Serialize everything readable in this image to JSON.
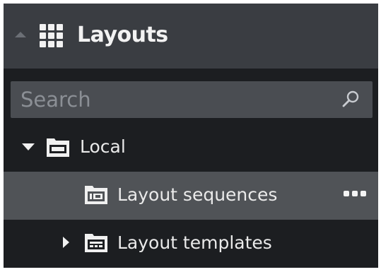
{
  "header": {
    "title": "Layouts",
    "collapse_icon": "collapse-up-arrow-icon",
    "section_icon": "grid-icon"
  },
  "search": {
    "value": "",
    "placeholder": "Search",
    "icon": "search-icon"
  },
  "tree": {
    "items": [
      {
        "label": "Local",
        "icon": "server-folder-icon",
        "expanded": true,
        "selected": false
      },
      {
        "label": "Layout sequences",
        "icon": "layout-sequence-icon",
        "selected": true,
        "menu_icon": "more-options-icon"
      },
      {
        "label": "Layout templates",
        "icon": "layout-template-icon",
        "expanded": false,
        "selected": false
      }
    ]
  },
  "colors": {
    "panel_bg": "#1c1e21",
    "header_bg": "#3a3d42",
    "search_bg": "#4a4d52",
    "selected_bg": "#505357",
    "text": "#eaeaea"
  }
}
